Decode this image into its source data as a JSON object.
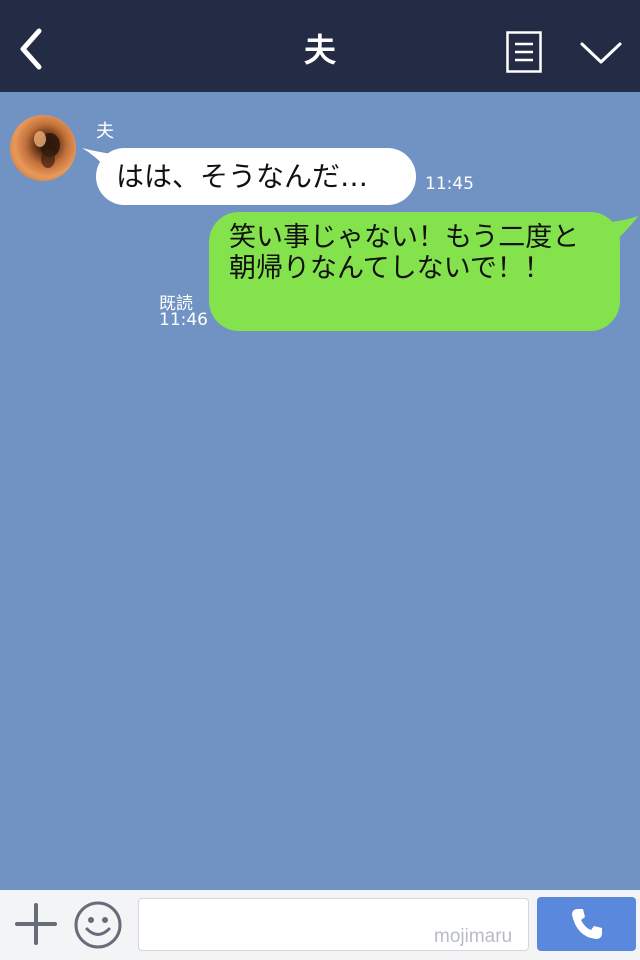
{
  "header": {
    "title": "夫",
    "back_icon": "chevron-left-icon",
    "menu_icon": "menu-list-icon",
    "expand_icon": "chevron-down-icon"
  },
  "messages": [
    {
      "direction": "incoming",
      "sender": "夫",
      "text": "はは、そうなんだ…",
      "time": "11:45"
    },
    {
      "direction": "outgoing",
      "text": "笑い事じゃない！もう二度と朝帰りなんてしないで！！",
      "read_label": "既読",
      "time": "11:46"
    }
  ],
  "composer": {
    "plus_icon": "plus-icon",
    "emoji_icon": "smiley-icon",
    "input_value": "",
    "watermark": "mojimaru",
    "call_icon": "phone-icon"
  },
  "colors": {
    "header_bg": "#232c44",
    "chat_bg": "#7093c3",
    "incoming_bubble": "#ffffff",
    "outgoing_bubble": "#84e34d",
    "call_button": "#5a88dc"
  }
}
